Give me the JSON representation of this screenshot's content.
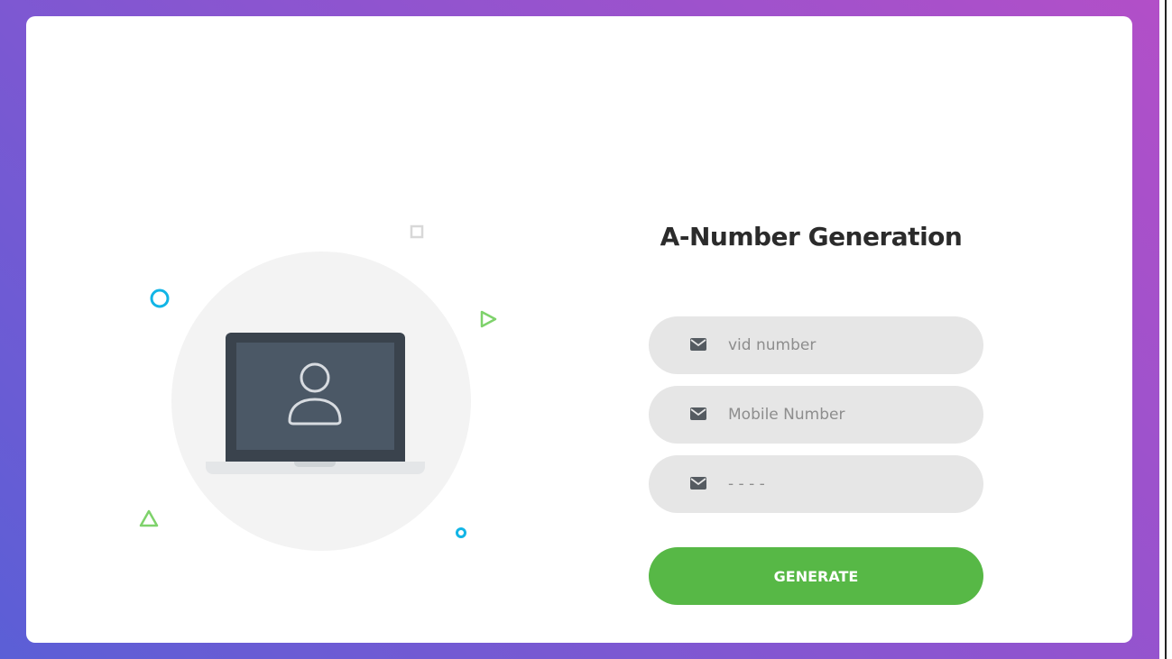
{
  "form": {
    "title": "A-Number Generation",
    "fields": [
      {
        "placeholder": "vid number",
        "value": "",
        "icon": "envelope-icon"
      },
      {
        "placeholder": "Mobile Number",
        "value": "",
        "icon": "envelope-icon"
      },
      {
        "placeholder": "- - - -",
        "value": "",
        "icon": "envelope-icon"
      }
    ],
    "submit_label": "GENERATE"
  },
  "illustration": {
    "icon": "user-icon",
    "device": "laptop-icon"
  },
  "colors": {
    "background_gradient_start": "#5b5fd6",
    "background_gradient_end": "#b24fc8",
    "card": "#ffffff",
    "field_background": "#e6e6e6",
    "button": "#57b846",
    "laptop_frame": "#3a434d",
    "laptop_display": "#4b5866",
    "accent_blue": "#12b5e6",
    "accent_green": "#7ed26b"
  }
}
